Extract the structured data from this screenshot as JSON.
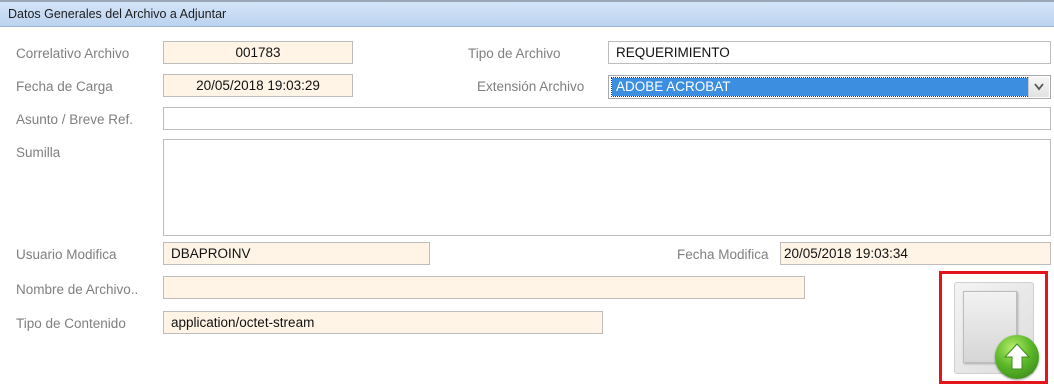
{
  "header": {
    "title": "Datos Generales del Archivo a Adjuntar"
  },
  "labels": {
    "correlativo": "Correlativo Archivo",
    "tipo_archivo": "Tipo de Archivo",
    "fecha_carga": "Fecha de Carga",
    "extension": "Extensión Archivo",
    "asunto": "Asunto / Breve Ref.",
    "sumilla": "Sumilla",
    "usuario_modifica": "Usuario Modifica",
    "fecha_modifica": "Fecha Modifica",
    "nombre_archivo": "Nombre de Archivo..",
    "tipo_contenido": "Tipo de Contenido"
  },
  "values": {
    "correlativo": "001783",
    "tipo_archivo": "REQUERIMIENTO",
    "fecha_carga": "20/05/2018 19:03:29",
    "extension": "ADOBE ACROBAT",
    "asunto": "",
    "sumilla": "",
    "usuario_modifica": "DBAPROINV",
    "fecha_modifica": "20/05/2018 19:03:34",
    "nombre_archivo": "",
    "tipo_contenido": "application/octet-stream"
  },
  "icons": {
    "dropdown": "chevron-down-icon",
    "upload": "upload-arrow-icon"
  },
  "colors": {
    "header_bg": "#c6dbf4",
    "readonly_bg": "#fff4e6",
    "selection": "#3b8ee0",
    "highlight": "#e3151b",
    "upload_green": "#5cb82a"
  }
}
